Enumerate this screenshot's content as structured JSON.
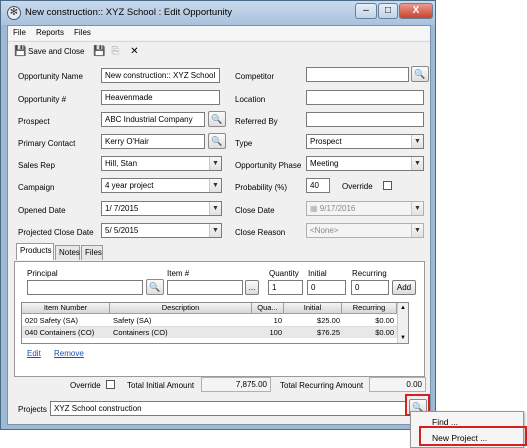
{
  "window": {
    "title": "New construction:: XYZ School : Edit Opportunity",
    "controls": {
      "minimize": "–",
      "maximize": "□",
      "close": "X"
    }
  },
  "menu": [
    "File",
    "Reports",
    "Files"
  ],
  "toolbar": {
    "save_close": "Save and Close"
  },
  "fields": {
    "opportunity_name": {
      "label": "Opportunity Name",
      "value": "New construction:: XYZ School"
    },
    "opportunity_num": {
      "label": "Opportunity #",
      "value": "Heavenmade"
    },
    "prospect": {
      "label": "Prospect",
      "value": "ABC Industrial Company"
    },
    "primary_contact": {
      "label": "Primary Contact",
      "value": "Kerry O'Hair"
    },
    "sales_rep": {
      "label": "Sales Rep",
      "value": "Hill, Stan"
    },
    "campaign": {
      "label": "Campaign",
      "value": "4 year project"
    },
    "opened_date": {
      "label": "Opened Date",
      "value": "1/ 7/2015"
    },
    "projected_close": {
      "label": "Projected Close Date",
      "value": "5/ 5/2015"
    },
    "competitor": {
      "label": "Competitor",
      "value": ""
    },
    "location": {
      "label": "Location",
      "value": ""
    },
    "referred_by": {
      "label": "Referred By",
      "value": ""
    },
    "type": {
      "label": "Type",
      "value": "Prospect"
    },
    "phase": {
      "label": "Opportunity Phase",
      "value": "Meeting"
    },
    "probability": {
      "label": "Probability (%)",
      "value": "40"
    },
    "override": {
      "label": "Override"
    },
    "close_date": {
      "label": "Close Date",
      "value": "9/17/2016"
    },
    "close_reason": {
      "label": "Close Reason",
      "value": "<None>"
    }
  },
  "tabs": [
    "Products",
    "Notes",
    "Files"
  ],
  "products": {
    "principal_label": "Principal",
    "item_label": "Item #",
    "quantity_label": "Quantity",
    "initial_label": "Initial",
    "recurring_label": "Recurring",
    "quantity_value": "1",
    "initial_value": "0",
    "recurring_value": "0",
    "item_browse": "...",
    "add_button": "Add",
    "columns": [
      "Item Number",
      "Description",
      "Qua...",
      "Initial",
      "Recurring"
    ],
    "rows": [
      {
        "item": "020 Safety (SA)",
        "desc": "Safety (SA)",
        "qty": "10",
        "initial": "$25.00",
        "recurring": "$0.00"
      },
      {
        "item": "040 Containers (CO)",
        "desc": "Containers (CO)",
        "qty": "100",
        "initial": "$76.25",
        "recurring": "$0.00"
      }
    ],
    "edit_link": "Edit",
    "remove_link": "Remove"
  },
  "totals": {
    "override_label": "Override",
    "initial_label": "Total Initial Amount",
    "initial_value": "7,875.00",
    "recurring_label": "Total Recurring Amount",
    "recurring_value": "0.00"
  },
  "projects": {
    "label": "Projects",
    "value": "XYZ School construction"
  },
  "context_menu": [
    "Find ...",
    "New Project ..."
  ],
  "colors": {
    "highlight": "#d42020",
    "link": "#1a4fb0"
  }
}
